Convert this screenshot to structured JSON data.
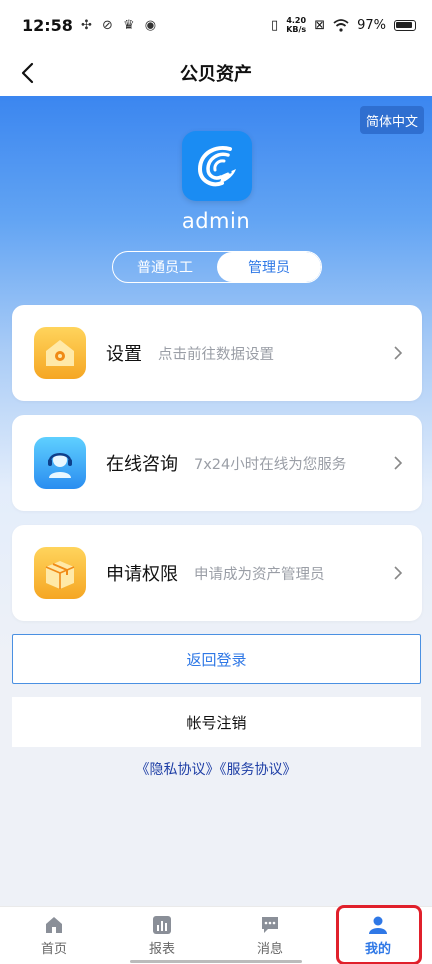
{
  "status_bar": {
    "time": "12:58",
    "net_speed_value": "4.20",
    "net_speed_unit": "KB/s",
    "battery": "97%"
  },
  "nav": {
    "title": "公贝资产"
  },
  "language_button": "简体中文",
  "profile": {
    "username": "admin",
    "roles": [
      "普通员工",
      "管理员"
    ],
    "active_role": "管理员"
  },
  "menu": [
    {
      "name": "设置",
      "desc": "点击前往数据设置",
      "icon": "settings-house-icon"
    },
    {
      "name": "在线咨询",
      "desc": "7x24小时在线为您服务",
      "icon": "headset-support-icon"
    },
    {
      "name": "申请权限",
      "desc": "申请成为资产管理员",
      "icon": "permission-box-icon"
    }
  ],
  "buttons": {
    "return_login": "返回登录",
    "cancel_account": "帐号注销"
  },
  "agreements": {
    "privacy": "《隐私协议》",
    "service": "《服务协议》"
  },
  "tabs": [
    {
      "label": "首页",
      "icon": "home-icon"
    },
    {
      "label": "报表",
      "icon": "report-icon"
    },
    {
      "label": "消息",
      "icon": "message-icon"
    },
    {
      "label": "我的",
      "icon": "user-icon"
    }
  ],
  "colors": {
    "primary": "#2f78e6",
    "highlight": "#e0202b"
  }
}
